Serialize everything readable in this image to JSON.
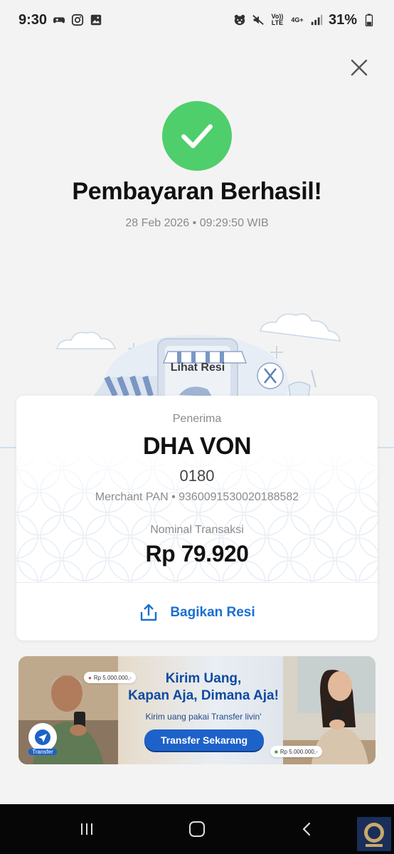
{
  "status_bar": {
    "time": "9:30",
    "battery": "31%",
    "network": [
      "Vo)) LTE",
      "4G+"
    ]
  },
  "header": {
    "close_icon": "close-icon"
  },
  "success": {
    "icon": "check-circle-icon",
    "title": "Pembayaran Berhasil!",
    "datetime": "28 Feb 2026 • 09:29:50 WIB"
  },
  "illustration": {
    "label": "Lihat Resi"
  },
  "receipt": {
    "recipient_label": "Penerima",
    "recipient_name": "DHA VON",
    "recipient_id": "0180",
    "merchant_pan": "Merchant PAN • 9360091530020188582",
    "amount_label": "Nominal Transaksi",
    "amount": "Rp 79.920",
    "share_label": "Bagikan Resi",
    "share_icon": "share-icon"
  },
  "banner": {
    "headline_1": "Kirim Uang,",
    "headline_2": "Kapan Aja, Dimana Aja!",
    "subtitle": "Kirim uang pakai Transfer livin'",
    "cta": "Transfer Sekarang",
    "chip_left": "Rp 5.000.000,-",
    "chip_right": "Rp 5.000.000,-",
    "badge_label": "Transfer"
  },
  "nav": {
    "recents_icon": "recents-icon",
    "home_icon": "home-icon",
    "back_icon": "back-icon"
  },
  "colors": {
    "success_green": "#4fce6c",
    "link_blue": "#1a6fd0",
    "cta_blue": "#1d62c9"
  }
}
